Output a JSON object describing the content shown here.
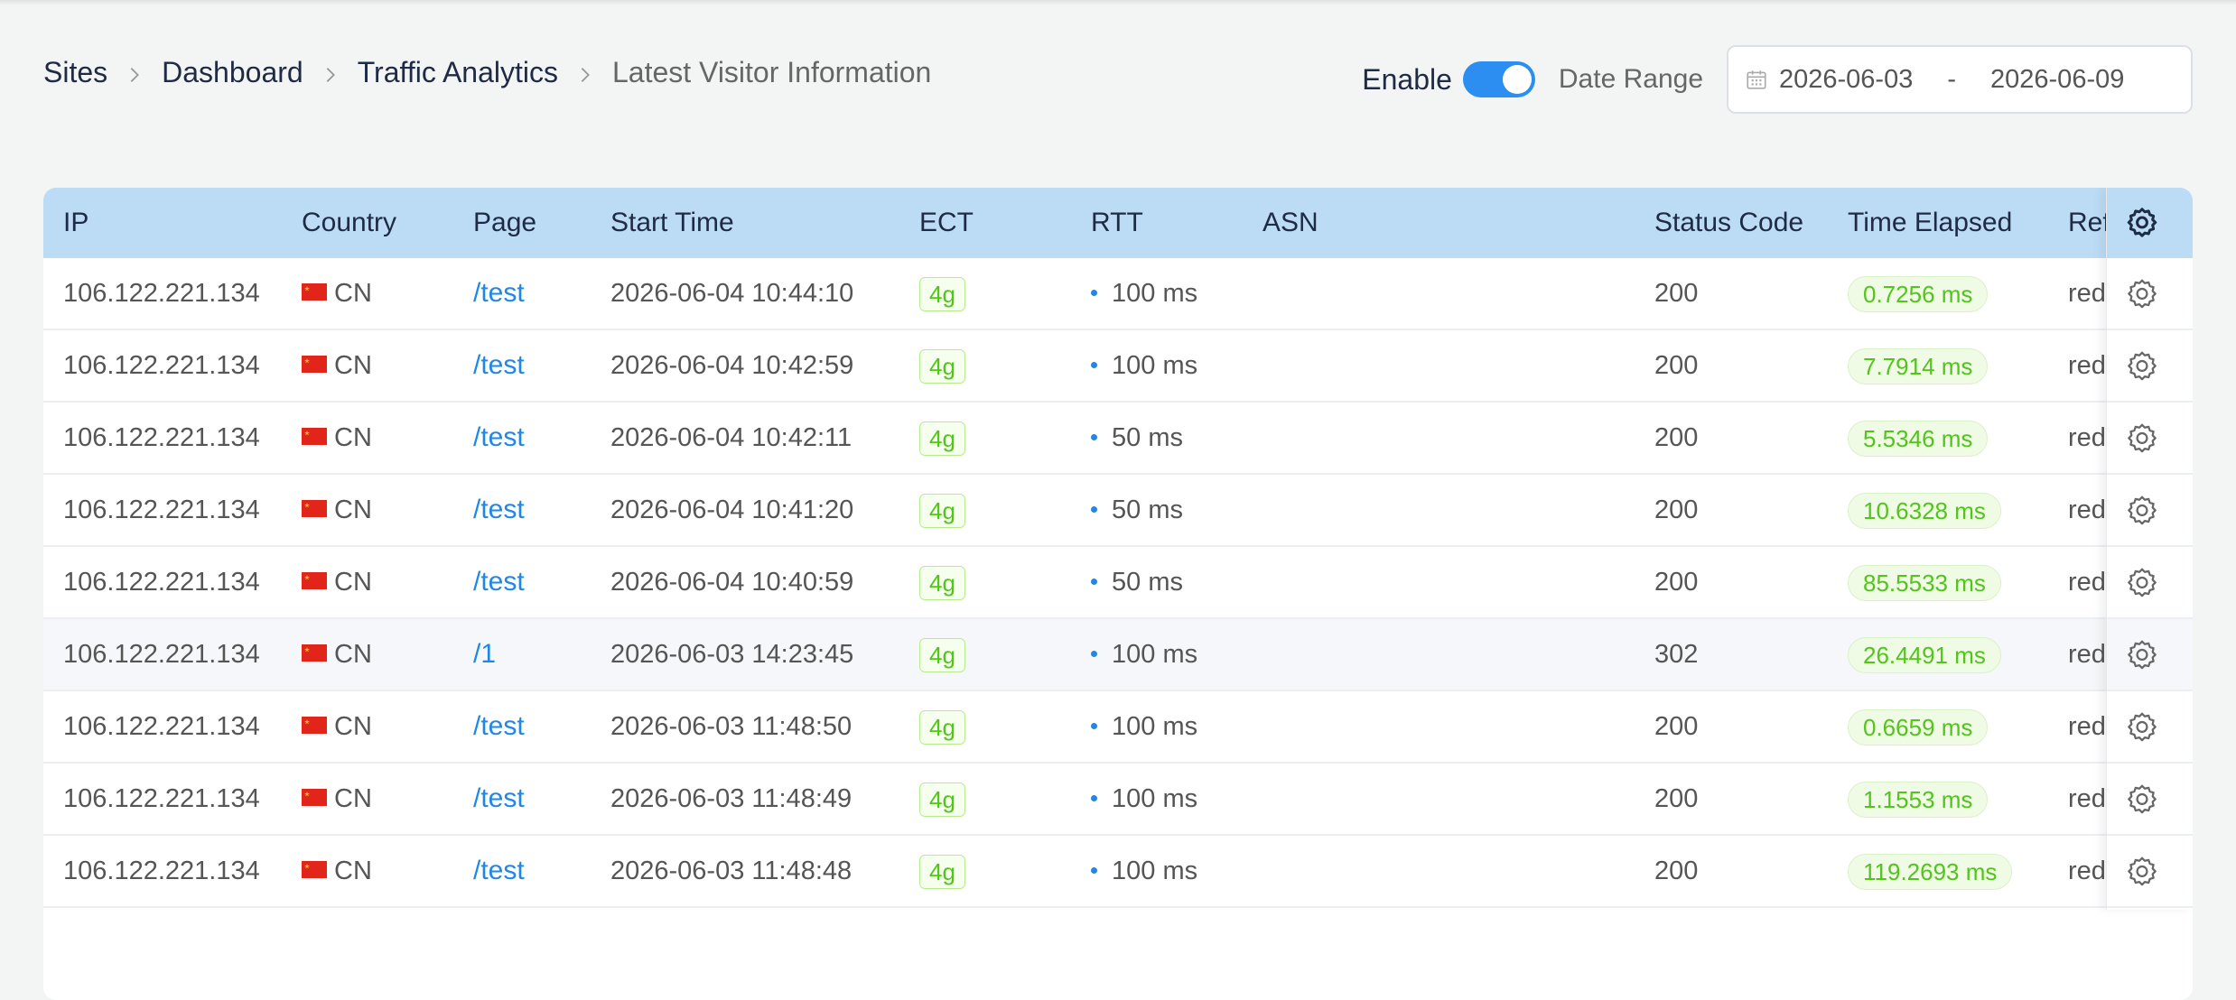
{
  "breadcrumb": {
    "items": [
      "Sites",
      "Dashboard",
      "Traffic Analytics",
      "Latest Visitor Information"
    ]
  },
  "controls": {
    "enable_label": "Enable",
    "enabled": true,
    "date_range_label": "Date Range",
    "start_date": "2026-06-03",
    "separator": "-",
    "end_date": "2026-06-09"
  },
  "table": {
    "columns": [
      "IP",
      "Country",
      "Page",
      "Start Time",
      "ECT",
      "RTT",
      "ASN",
      "Status Code",
      "Time Elapsed",
      "Ref"
    ],
    "rows": [
      {
        "ip": "106.122.221.134",
        "country": "CN",
        "page": "/test",
        "start_time": "2026-06-04 10:44:10",
        "ect": "4g",
        "rtt": "100 ms",
        "asn": "",
        "status": "200",
        "elapsed": "0.7256 ms",
        "ref": "red"
      },
      {
        "ip": "106.122.221.134",
        "country": "CN",
        "page": "/test",
        "start_time": "2026-06-04 10:42:59",
        "ect": "4g",
        "rtt": "100 ms",
        "asn": "",
        "status": "200",
        "elapsed": "7.7914 ms",
        "ref": "red"
      },
      {
        "ip": "106.122.221.134",
        "country": "CN",
        "page": "/test",
        "start_time": "2026-06-04 10:42:11",
        "ect": "4g",
        "rtt": "50 ms",
        "asn": "",
        "status": "200",
        "elapsed": "5.5346 ms",
        "ref": "red"
      },
      {
        "ip": "106.122.221.134",
        "country": "CN",
        "page": "/test",
        "start_time": "2026-06-04 10:41:20",
        "ect": "4g",
        "rtt": "50 ms",
        "asn": "",
        "status": "200",
        "elapsed": "10.6328 ms",
        "ref": "red"
      },
      {
        "ip": "106.122.221.134",
        "country": "CN",
        "page": "/test",
        "start_time": "2026-06-04 10:40:59",
        "ect": "4g",
        "rtt": "50 ms",
        "asn": "",
        "status": "200",
        "elapsed": "85.5533 ms",
        "ref": "red"
      },
      {
        "ip": "106.122.221.134",
        "country": "CN",
        "page": "/1",
        "start_time": "2026-06-03 14:23:45",
        "ect": "4g",
        "rtt": "100 ms",
        "asn": "",
        "status": "302",
        "elapsed": "26.4491 ms",
        "ref": "red"
      },
      {
        "ip": "106.122.221.134",
        "country": "CN",
        "page": "/test",
        "start_time": "2026-06-03 11:48:50",
        "ect": "4g",
        "rtt": "100 ms",
        "asn": "",
        "status": "200",
        "elapsed": "0.6659 ms",
        "ref": "red"
      },
      {
        "ip": "106.122.221.134",
        "country": "CN",
        "page": "/test",
        "start_time": "2026-06-03 11:48:49",
        "ect": "4g",
        "rtt": "100 ms",
        "asn": "",
        "status": "200",
        "elapsed": "1.1553 ms",
        "ref": "red"
      },
      {
        "ip": "106.122.221.134",
        "country": "CN",
        "page": "/test",
        "start_time": "2026-06-03 11:48:48",
        "ect": "4g",
        "rtt": "100 ms",
        "asn": "",
        "status": "200",
        "elapsed": "119.2693 ms",
        "ref": "red"
      }
    ],
    "hover_row_index": 5
  },
  "icons": {
    "breadcrumb_separator": "chevron-right-icon",
    "date": "calendar-icon",
    "settings": "gear-icon",
    "flag": "china-flag-icon"
  },
  "colors": {
    "accent": "#2b8ef0",
    "link": "#1e88e5",
    "header_bg": "#bcdcf6",
    "success_text": "#52c41a",
    "success_bg": "#f0fbe6"
  }
}
